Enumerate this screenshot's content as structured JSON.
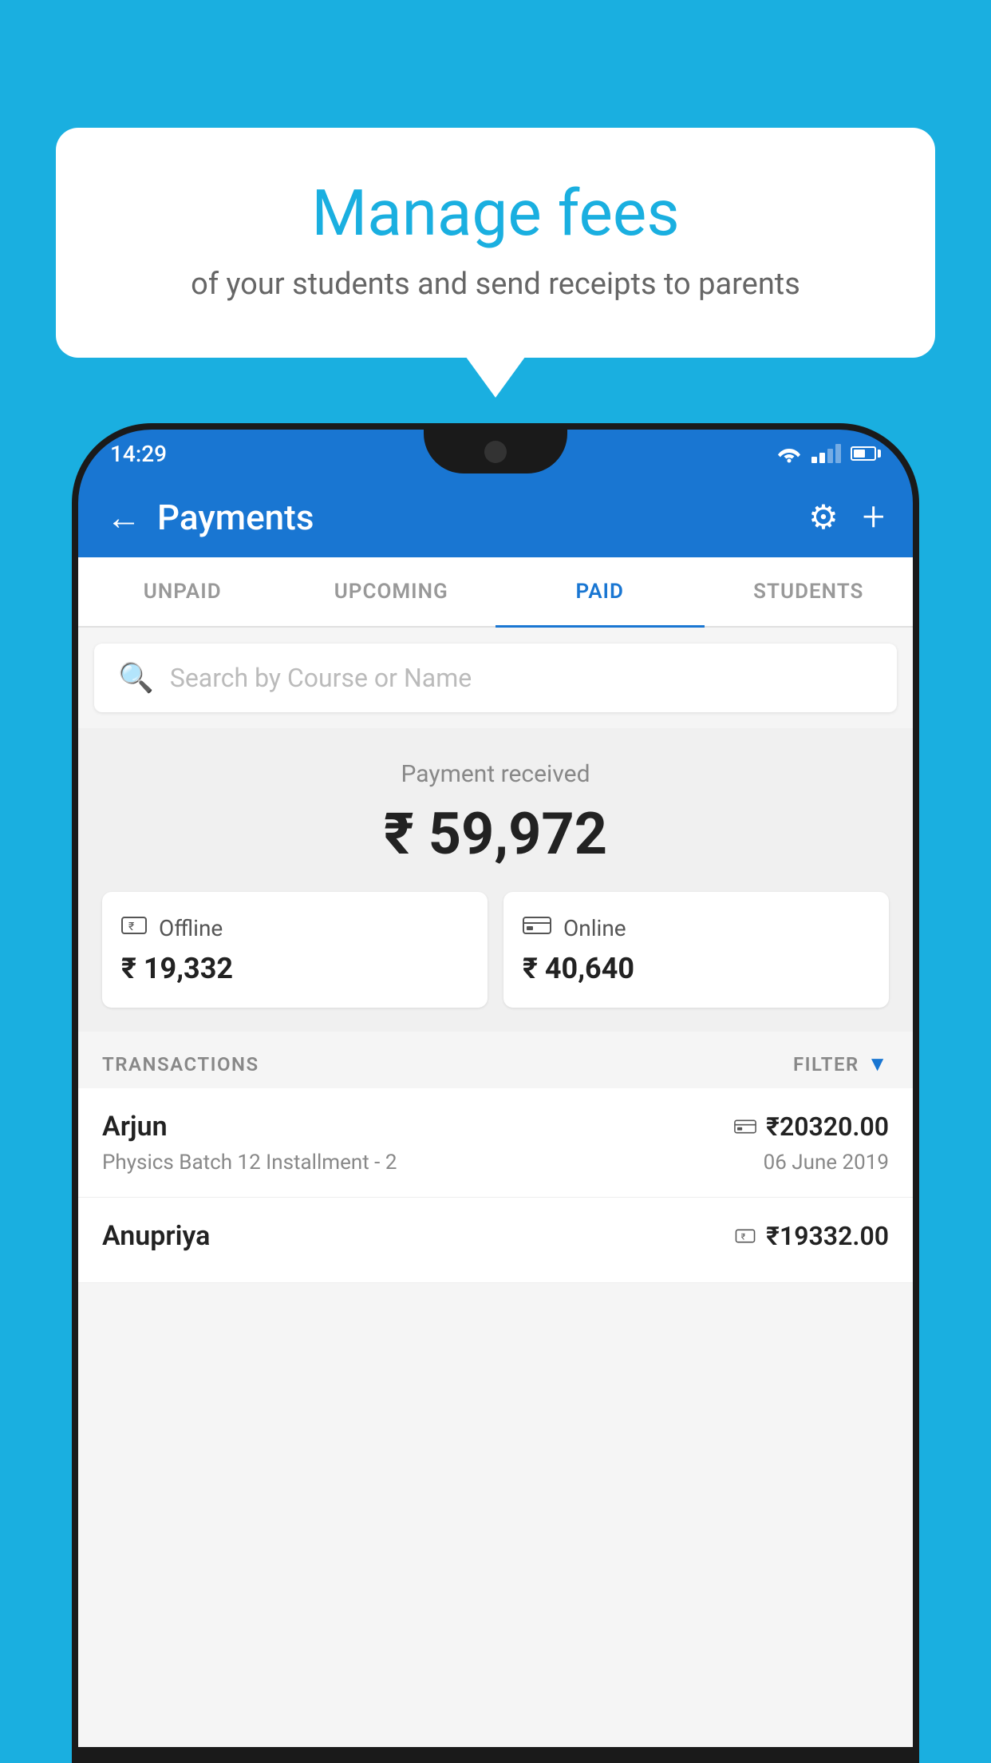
{
  "background_color": "#1AAFE0",
  "speech_bubble": {
    "title": "Manage fees",
    "subtitle": "of your students and send receipts to parents"
  },
  "status_bar": {
    "time": "14:29"
  },
  "header": {
    "title": "Payments",
    "back_label": "←",
    "settings_label": "⚙",
    "add_label": "+"
  },
  "tabs": [
    {
      "label": "UNPAID",
      "active": false
    },
    {
      "label": "UPCOMING",
      "active": false
    },
    {
      "label": "PAID",
      "active": true
    },
    {
      "label": "STUDENTS",
      "active": false
    }
  ],
  "search": {
    "placeholder": "Search by Course or Name"
  },
  "payment_received": {
    "label": "Payment received",
    "amount": "₹ 59,972",
    "offline": {
      "type": "Offline",
      "amount": "₹ 19,332"
    },
    "online": {
      "type": "Online",
      "amount": "₹ 40,640"
    }
  },
  "transactions": {
    "section_label": "TRANSACTIONS",
    "filter_label": "FILTER",
    "items": [
      {
        "name": "Arjun",
        "course": "Physics Batch 12 Installment - 2",
        "amount": "₹20320.00",
        "date": "06 June 2019",
        "type": "online"
      },
      {
        "name": "Anupriya",
        "course": "",
        "amount": "₹19332.00",
        "date": "",
        "type": "offline"
      }
    ]
  }
}
